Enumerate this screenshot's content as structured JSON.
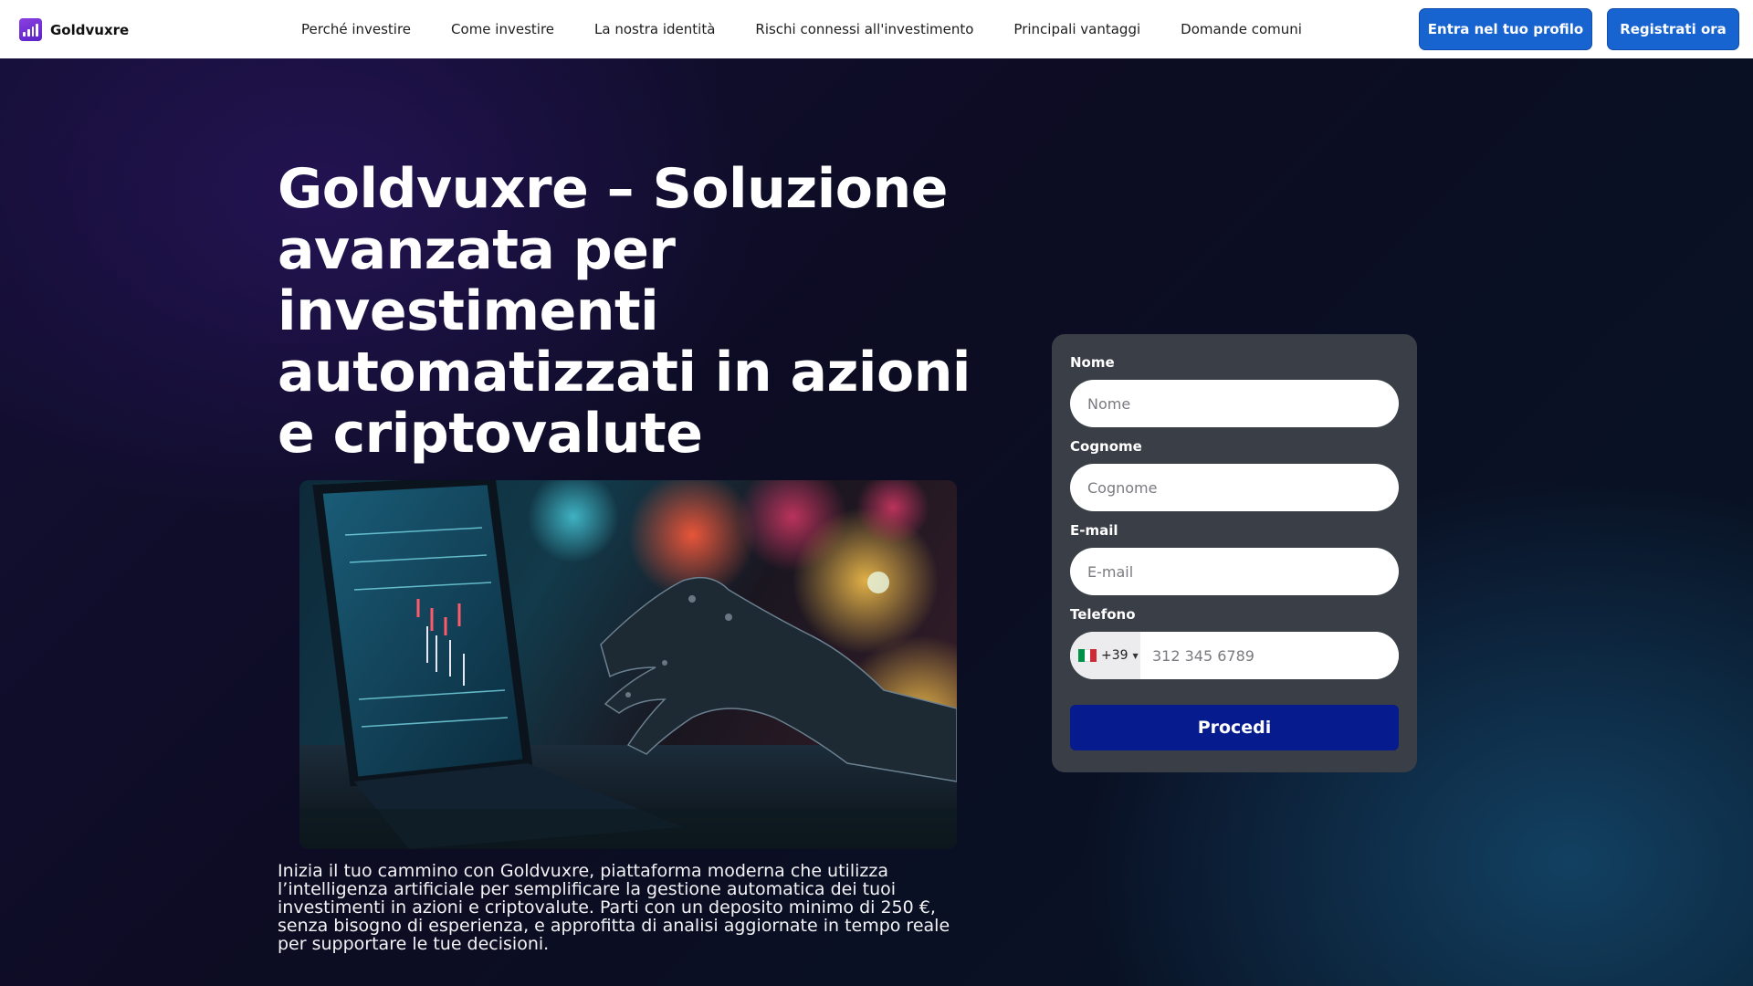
{
  "header": {
    "brand": "Goldvuxre",
    "nav": [
      "Perché investire",
      "Come investire",
      "La nostra identità",
      "Rischi connessi all'investimento",
      "Principali vantaggi",
      "Domande comuni"
    ],
    "login_label": "Entra nel tuo profilo",
    "register_label": "Registrati ora"
  },
  "hero": {
    "title": "Goldvuxre – Soluzione avanzata per investimenti automatizzati in azioni e criptovalute",
    "description": "Inizia il tuo cammino con Goldvuxre, piattaforma moderna che utilizza l’intelligenza artificiale per semplificare la gestione automatica dei tuoi investimenti in azioni e criptovalute. Parti con un deposito minimo di 250 €, senza bisogno di esperienza, e approfitta di analisi aggiornate in tempo reale per supportare le tue decisioni."
  },
  "form": {
    "first_name_label": "Nome",
    "first_name_placeholder": "Nome",
    "last_name_label": "Cognome",
    "last_name_placeholder": "Cognome",
    "email_label": "E-mail",
    "email_placeholder": "E-mail",
    "phone_label": "Telefono",
    "phone_dial_code": "+39",
    "phone_placeholder": "312 345 6789",
    "submit_label": "Procedi"
  },
  "icons": {
    "brand_logo": "bar-chart-icon",
    "country_flag": "italy-flag-icon",
    "country_caret": "caret-down-icon"
  },
  "colors": {
    "accent_button": "#1763cf",
    "submit_button": "#061b8e",
    "form_card": "#3a3e47",
    "brand_logo": "#7b32d9"
  }
}
